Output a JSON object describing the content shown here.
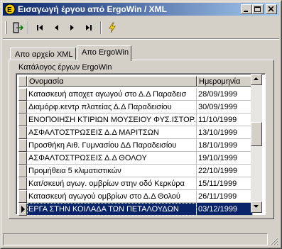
{
  "window": {
    "title": "Εισαγωγή έργου από ErgoWin / XML",
    "controls": [
      "minimize-icon",
      "maximize-icon",
      "close-icon"
    ]
  },
  "toolbar": {
    "buttons": [
      {
        "name": "import-button",
        "icon": "import-door-icon"
      },
      {
        "name": "first-record-button",
        "icon": "skip-first-icon"
      },
      {
        "name": "prior-record-button",
        "icon": "prior-icon"
      },
      {
        "name": "next-record-button",
        "icon": "next-icon"
      },
      {
        "name": "last-record-button",
        "icon": "skip-last-icon"
      },
      {
        "name": "execute-button",
        "icon": "lightning-icon"
      }
    ]
  },
  "tabs": [
    {
      "label": "Απο αρχείο XML",
      "active": false
    },
    {
      "label": "Απο ErgoWin",
      "active": true
    }
  ],
  "panel": {
    "label": "Κατάλογος έργων ErgoWin"
  },
  "grid": {
    "columns": [
      "Ονομασία",
      "Ημερομηνία"
    ],
    "rows": [
      {
        "name": "Κατασκευή αποχετ αγωγού στο Δ.Δ Παραδεισ",
        "date": "28/09/1999"
      },
      {
        "name": "Διαμόρφ.κεντρ πλατείας Δ.Δ Παραδεισίου",
        "date": "30/09/1999"
      },
      {
        "name": "ΕΝΟΠΟΙΗΣΗ ΚΤΙΡΙΩΝ ΜΟΥΣΕΙΟΥ ΦΥΣ.ΙΣΤΟΡ.ΠΕΤ",
        "date": "11/10/1999"
      },
      {
        "name": "ΑΣΦΑΛΤΟΣΤΡΩΣΕΙΣ Δ.Δ ΜΑΡΙΤΣΩΝ",
        "date": "13/10/1999"
      },
      {
        "name": "Προσθήκη Αιθ. Γυμνασίου ΔΔ Παραδεισίου",
        "date": "18/10/1999"
      },
      {
        "name": "ΑΣΦΑΛΤΟΣΤΡΩΣΕΙΣ Δ.Δ ΘΟΛΟΥ",
        "date": "19/10/1999"
      },
      {
        "name": "Προμήθεια 5 κλιματιστικών",
        "date": "22/10/1999"
      },
      {
        "name": "Κατ/σκευή αγωγ. ομβρίων στην οδό Κερκύρα",
        "date": "15/11/1999"
      },
      {
        "name": "Κατασκευή αγωγού ομβρίων στο Δ.Δ Θολού",
        "date": "26/11/1999"
      },
      {
        "name": "ΕΡΓΑ ΣΤΗΝ ΚΟΙΛΑΔΑ ΤΩΝ ΠΕΤΑΛΟΥΔΩΝ",
        "date": "03/12/1999",
        "selected": true
      }
    ]
  },
  "colors": {
    "title_gradient_start": "#0a246a",
    "title_gradient_end": "#a6caf0",
    "selection": "#0a246a",
    "face": "#d4d0c8"
  }
}
